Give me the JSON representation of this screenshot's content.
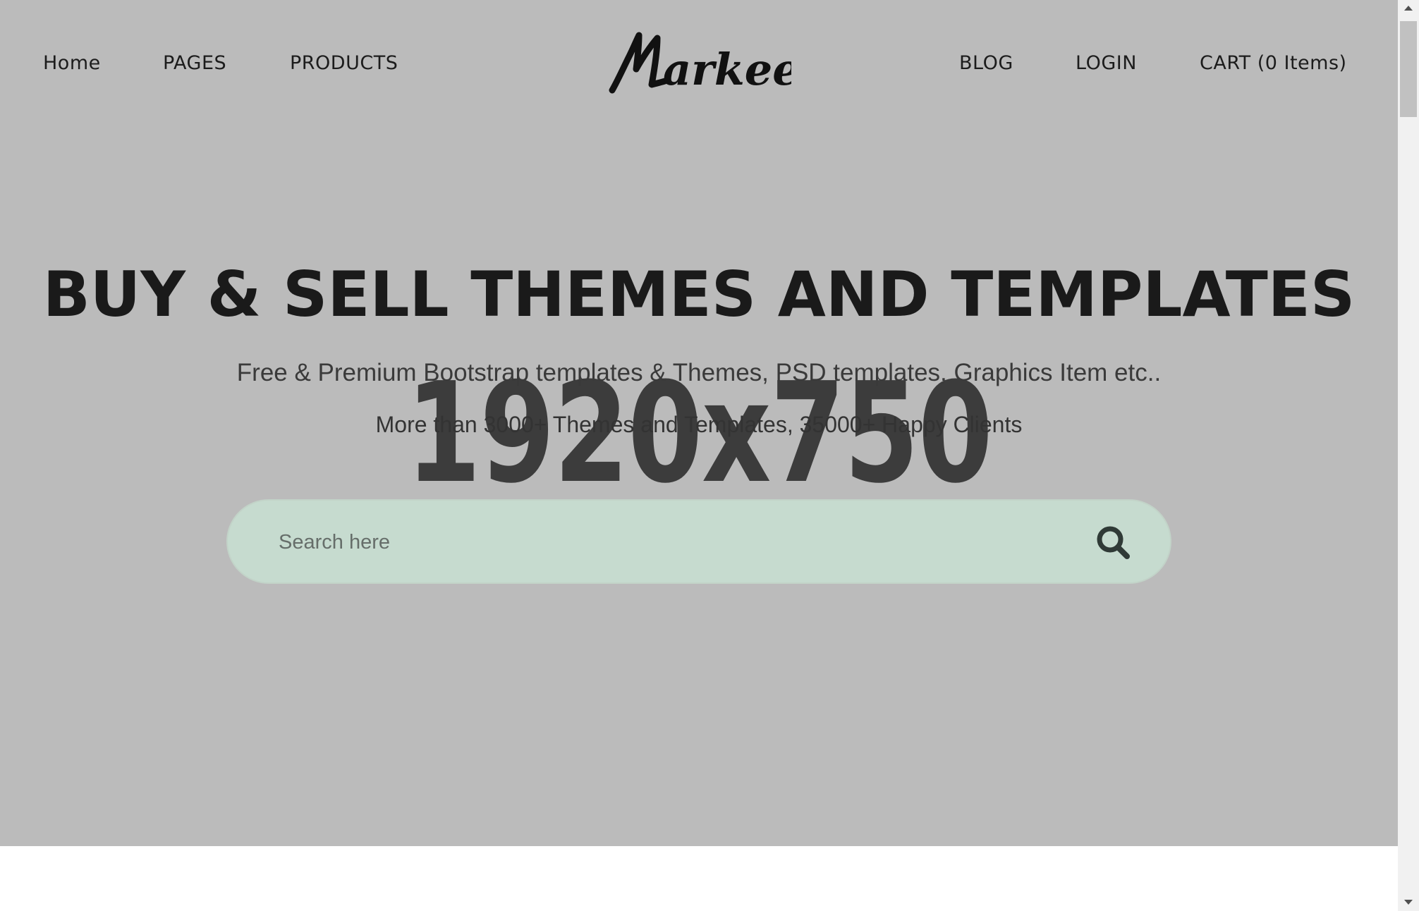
{
  "nav": {
    "left": [
      "Home",
      "PAGES",
      "PRODUCTS"
    ],
    "right": [
      "BLOG",
      "LOGIN",
      "CART (0 Items)"
    ]
  },
  "logo": {
    "text": "Markee"
  },
  "hero": {
    "placeholder": "1920x750",
    "title": "BUY & SELL THEMES AND TEMPLATES",
    "subtitle": "Free & Premium Bootstrap templates & Themes, PSD templates, Graphics Item etc..",
    "stats": "More than 3000+ Themes and Templates, 35000+ Happy Clients"
  },
  "search": {
    "placeholder": "Search here",
    "icon": "search-icon"
  },
  "colors": {
    "hero_bg": "#bbbbbb",
    "search_bg": "#c6dbcf",
    "text_dark": "#1a1a1a"
  }
}
